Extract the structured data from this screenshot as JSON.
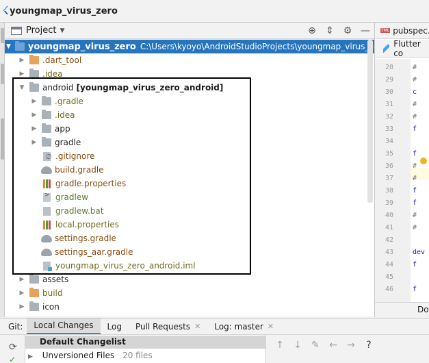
{
  "window": {
    "title": "youngmap_virus_zero",
    "logo_icon": "flutter-logo-icon"
  },
  "project_panel": {
    "label": "Project",
    "dropdown_icon": "chevron-down-icon",
    "tools": [
      "target-icon",
      "collapse-icon",
      "gear-icon",
      "minimize-icon"
    ],
    "tools_glyphs": [
      "⊕",
      "⇕",
      "⚙",
      "—"
    ]
  },
  "tree": {
    "root": {
      "name": "youngmap_virus_zero",
      "path": "C:\\Users\\kyoyo\\AndroidStudioProjects\\youngmap_virus_zero"
    },
    "items": [
      {
        "label": ".dart_tool"
      },
      {
        "label": ".idea"
      },
      {
        "label": "android",
        "module": "[youngmap_virus_zero_android]"
      },
      {
        "label": ".gradle"
      },
      {
        "label": ".idea"
      },
      {
        "label": "app"
      },
      {
        "label": "gradle"
      },
      {
        "label": ".gitignore"
      },
      {
        "label": "build.gradle"
      },
      {
        "label": "gradle.properties"
      },
      {
        "label": "gradlew"
      },
      {
        "label": "gradlew.bat"
      },
      {
        "label": "local.properties"
      },
      {
        "label": "settings.gradle"
      },
      {
        "label": "settings_aar.gradle"
      },
      {
        "label": "youngmap_virus_zero_android.iml"
      },
      {
        "label": "assets"
      },
      {
        "label": "build"
      },
      {
        "label": "icon"
      }
    ]
  },
  "editor": {
    "tab1": "pubspec.y",
    "tab1_badge": "YML",
    "tab2": "Flutter co",
    "line_numbers": [
      "28",
      "29",
      "30",
      "31",
      "32",
      "33",
      "34",
      "35",
      "36",
      "37",
      "38",
      "39",
      "40",
      "41",
      "42",
      "43",
      "44",
      "45",
      "46"
    ],
    "code": [
      "#",
      "#",
      "c",
      "#",
      "#",
      "f",
      "",
      "f",
      "#",
      "#",
      "f",
      "f",
      "#",
      "#",
      "",
      "dev",
      "f",
      "",
      "f"
    ],
    "bottom_label": "Do"
  },
  "git": {
    "tabs": [
      "Git:",
      "Local Changes",
      "Log",
      "Pull Requests",
      "Log: master"
    ],
    "close_glyph": "✕",
    "changelist": {
      "header": "Default Changelist",
      "row_label": "Unversioned Files",
      "row_count": "20 files"
    },
    "tool_glyphs": [
      "↑",
      "↓",
      "✎",
      "←",
      "→",
      "?"
    ],
    "tool_icons": [
      "arrow-up-icon",
      "arrow-down-icon",
      "edit-icon",
      "arrow-left-icon",
      "arrow-right-icon",
      "help-icon"
    ],
    "refresh_glyph": "⟳",
    "check_glyph": "✓"
  }
}
